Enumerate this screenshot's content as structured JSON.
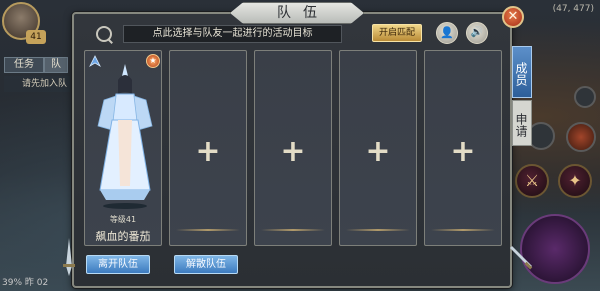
{
  "panel": {
    "title": "队伍",
    "goal_prompt": "点此选择与队友一起进行的活动目标",
    "auto_button": "开启匹配",
    "tabs": [
      "成员",
      "申请"
    ],
    "members": [
      {
        "level_label": "等级41",
        "name": "飙血的番茄"
      }
    ],
    "empty_slot_symbol": "+",
    "actions": {
      "leave": "离开队伍",
      "disband": "解散队伍"
    }
  },
  "hud": {
    "level": "41",
    "task_tab": "任务",
    "team_tab": "队",
    "join_hint": "请先加入队",
    "coords": "(47, 477)",
    "status_bottom": "39% 昨 02"
  },
  "colors": {
    "accent_blue": "#3d7bbf",
    "gold": "#f1d78a",
    "close_red": "#a52a16"
  }
}
